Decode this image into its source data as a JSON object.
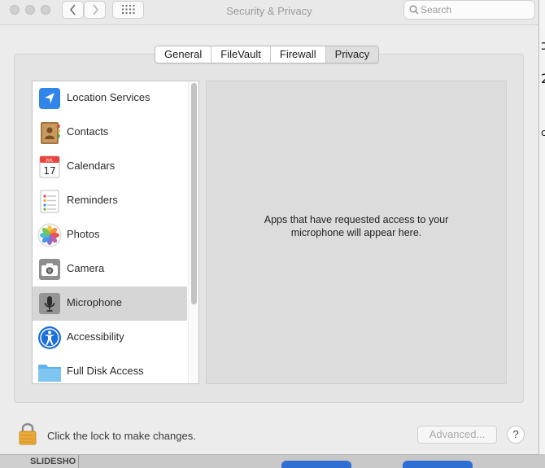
{
  "window": {
    "title": "Security & Privacy"
  },
  "toolbar": {
    "search_placeholder": "Search"
  },
  "tabs": [
    {
      "label": "General",
      "active": false
    },
    {
      "label": "FileVault",
      "active": false
    },
    {
      "label": "Firewall",
      "active": false
    },
    {
      "label": "Privacy",
      "active": true
    }
  ],
  "sidebar": {
    "items": [
      {
        "label": "Location Services",
        "icon": "location-arrow-icon",
        "selected": false
      },
      {
        "label": "Contacts",
        "icon": "contacts-book-icon",
        "selected": false
      },
      {
        "label": "Calendars",
        "icon": "calendar-icon",
        "selected": false,
        "calendar_month": "JUL",
        "calendar_day": "17"
      },
      {
        "label": "Reminders",
        "icon": "reminders-icon",
        "selected": false
      },
      {
        "label": "Photos",
        "icon": "photos-flower-icon",
        "selected": false
      },
      {
        "label": "Camera",
        "icon": "camera-icon",
        "selected": false
      },
      {
        "label": "Microphone",
        "icon": "microphone-icon",
        "selected": true
      },
      {
        "label": "Accessibility",
        "icon": "accessibility-icon",
        "selected": false
      },
      {
        "label": "Full Disk Access",
        "icon": "folder-icon",
        "selected": false
      }
    ]
  },
  "detail": {
    "message": "Apps that have requested access to your microphone will appear here."
  },
  "footer": {
    "lock_text": "Click the lock to make changes.",
    "advanced_label": "Advanced...",
    "help_label": "?"
  },
  "background": {
    "slideshow_label": "SLIDESHO"
  },
  "colors": {
    "selected_row": "#d6d6d6",
    "active_tab": "#dedede",
    "lock": "#e8a83a",
    "accent_blue": "#2f6fd4"
  }
}
